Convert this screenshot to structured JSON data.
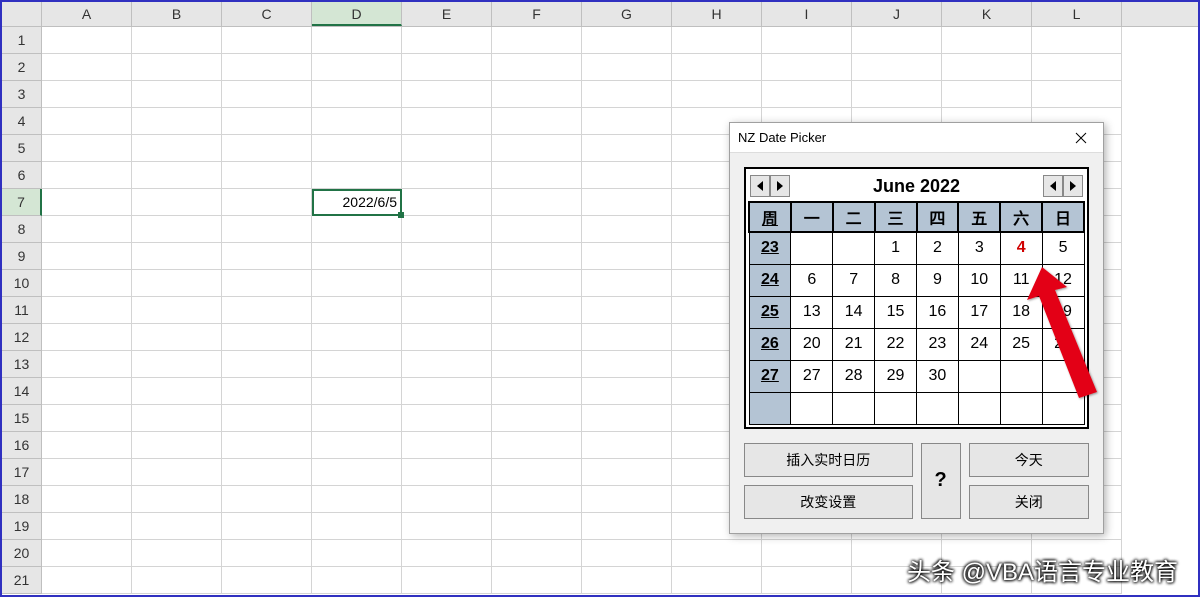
{
  "spreadsheet": {
    "columns": [
      "A",
      "B",
      "C",
      "D",
      "E",
      "F",
      "G",
      "H",
      "I",
      "J",
      "K",
      "L"
    ],
    "rows": [
      1,
      2,
      3,
      4,
      5,
      6,
      7,
      8,
      9,
      10,
      11,
      12,
      13,
      14,
      15,
      16,
      17,
      18,
      19,
      20,
      21
    ],
    "active_col": "D",
    "active_row": 7,
    "active_cell_value": "2022/6/5"
  },
  "datepicker": {
    "window_title": "NZ Date Picker",
    "month_title": "June 2022",
    "weekday_header": [
      "周",
      "一",
      "二",
      "三",
      "四",
      "五",
      "六",
      "日"
    ],
    "weeks": [
      {
        "wn": 23,
        "days": [
          "",
          "",
          "1",
          "2",
          "3",
          "4",
          "5"
        ]
      },
      {
        "wn": 24,
        "days": [
          "6",
          "7",
          "8",
          "9",
          "10",
          "11",
          "12"
        ]
      },
      {
        "wn": 25,
        "days": [
          "13",
          "14",
          "15",
          "16",
          "17",
          "18",
          "19"
        ]
      },
      {
        "wn": 26,
        "days": [
          "20",
          "21",
          "22",
          "23",
          "24",
          "25",
          "26"
        ]
      },
      {
        "wn": 27,
        "days": [
          "27",
          "28",
          "29",
          "30",
          "",
          "",
          ""
        ]
      },
      {
        "wn": "",
        "days": [
          "",
          "",
          "",
          "",
          "",
          "",
          ""
        ]
      }
    ],
    "today_day": "4",
    "buttons": {
      "insert": "插入实时日历",
      "settings": "改变设置",
      "question": "?",
      "today": "今天",
      "close": "关闭"
    }
  },
  "watermark": "头条 @VBA语言专业教育"
}
